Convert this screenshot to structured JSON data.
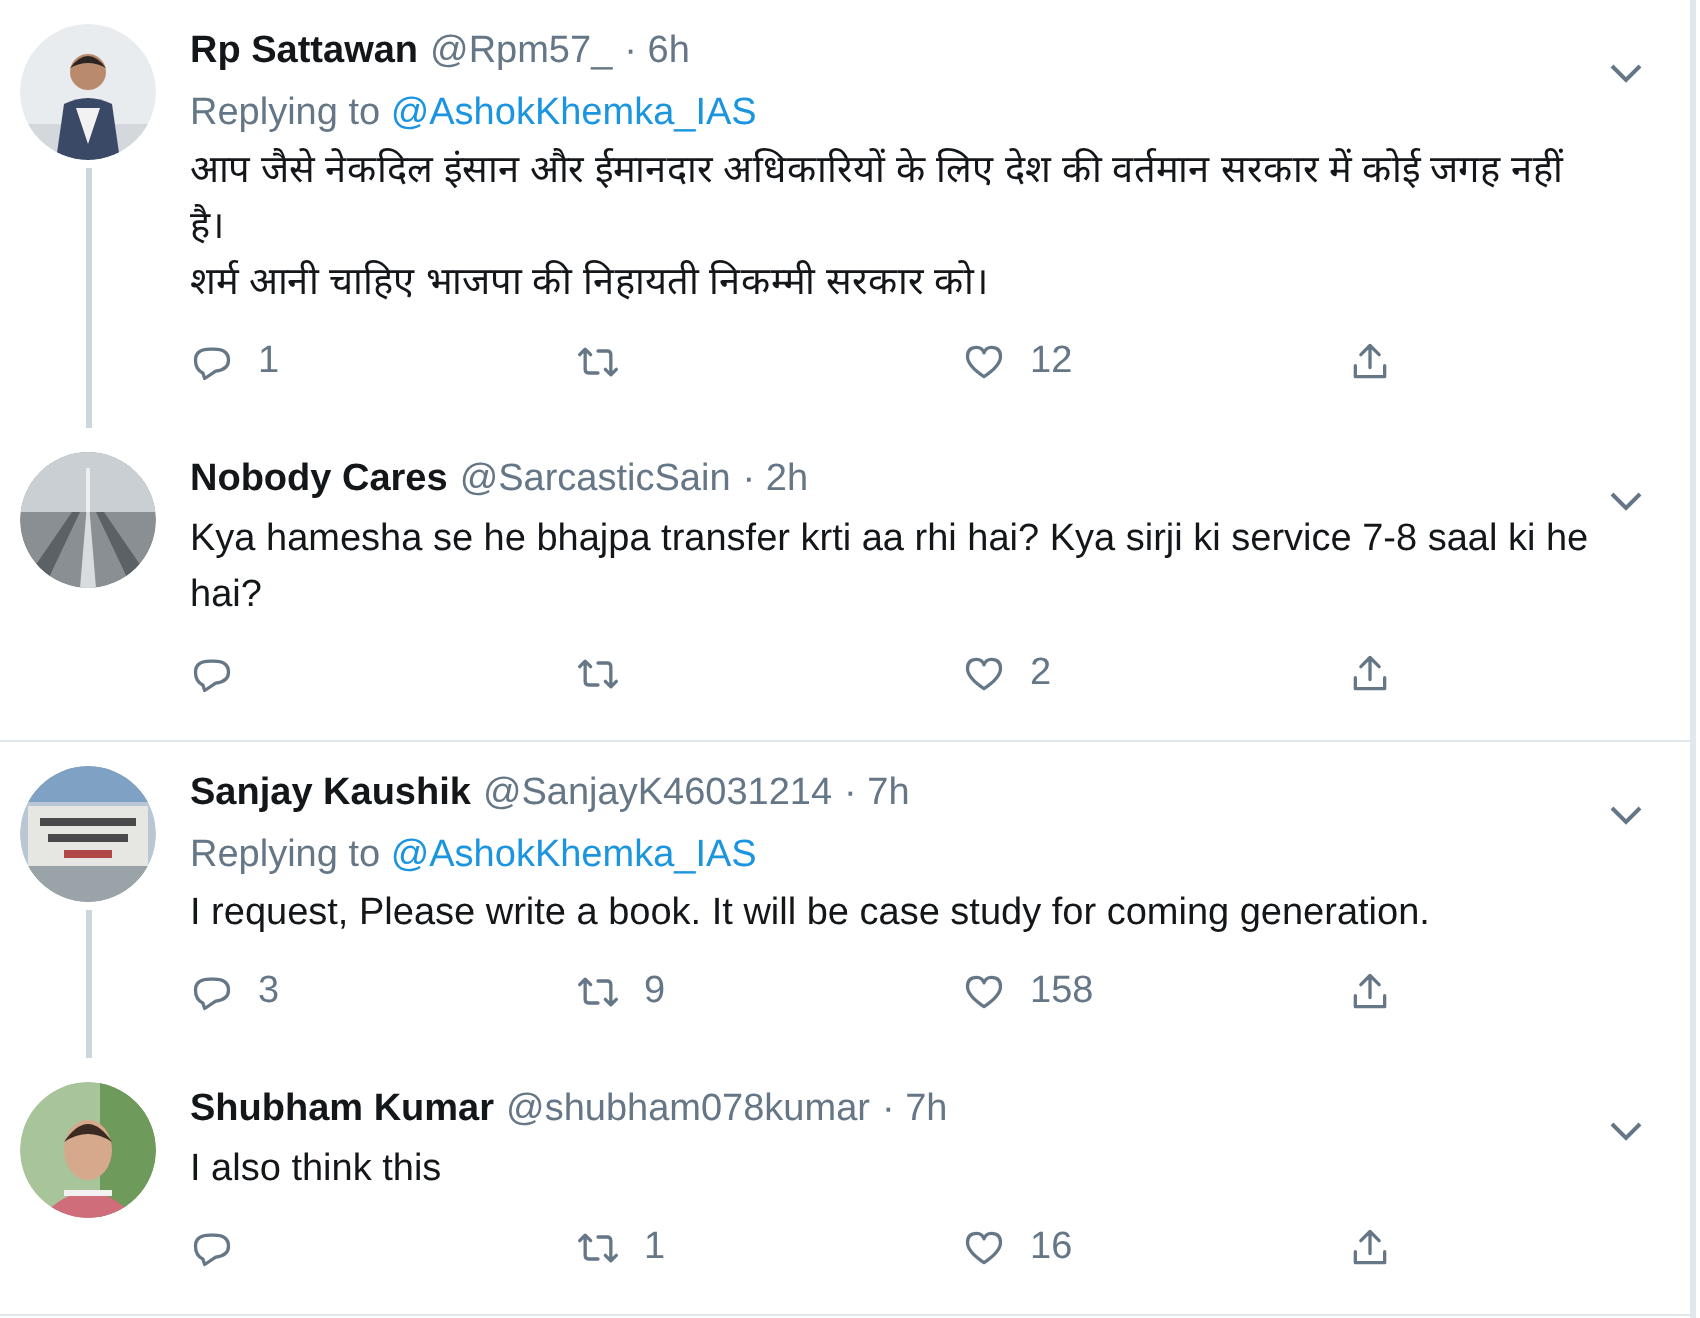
{
  "tweets": [
    {
      "name": "Rp Sattawan",
      "handle": "@Rpm57_",
      "time": "· 6h",
      "replying_label": "Replying to",
      "replying_to": "@AshokKhemka_IAS",
      "text": "आप जैसे नेकदिल इंसान और ईमानदार अधिकारियों के लिए देश की वर्तमान सरकार में कोई जगह नहीं है।\nशर्म आनी चाहिए भाजपा की निहायती निकम्मी सरकार को।",
      "replies": "1",
      "likes": "12",
      "thread_continues": true
    },
    {
      "name": "Nobody Cares",
      "handle": "@SarcasticSain",
      "time": "· 2h",
      "text": "Kya hamesha se he bhajpa transfer krti aa rhi hai? Kya sirji ki service 7-8 saal ki he hai?",
      "likes": "2",
      "thread_continues": false
    },
    {
      "name": "Sanjay Kaushik",
      "handle": "@SanjayK46031214",
      "time": "· 7h",
      "replying_label": "Replying to",
      "replying_to": "@AshokKhemka_IAS",
      "text": "I request, Please write a book. It will be case study for coming generation.",
      "replies": "3",
      "retweets": "9",
      "likes": "158",
      "thread_continues": true
    },
    {
      "name": "Shubham Kumar",
      "handle": "@shubham078kumar",
      "time": "· 7h",
      "text": "I also think this",
      "retweets": "1",
      "likes": "16",
      "thread_continues": false
    }
  ]
}
